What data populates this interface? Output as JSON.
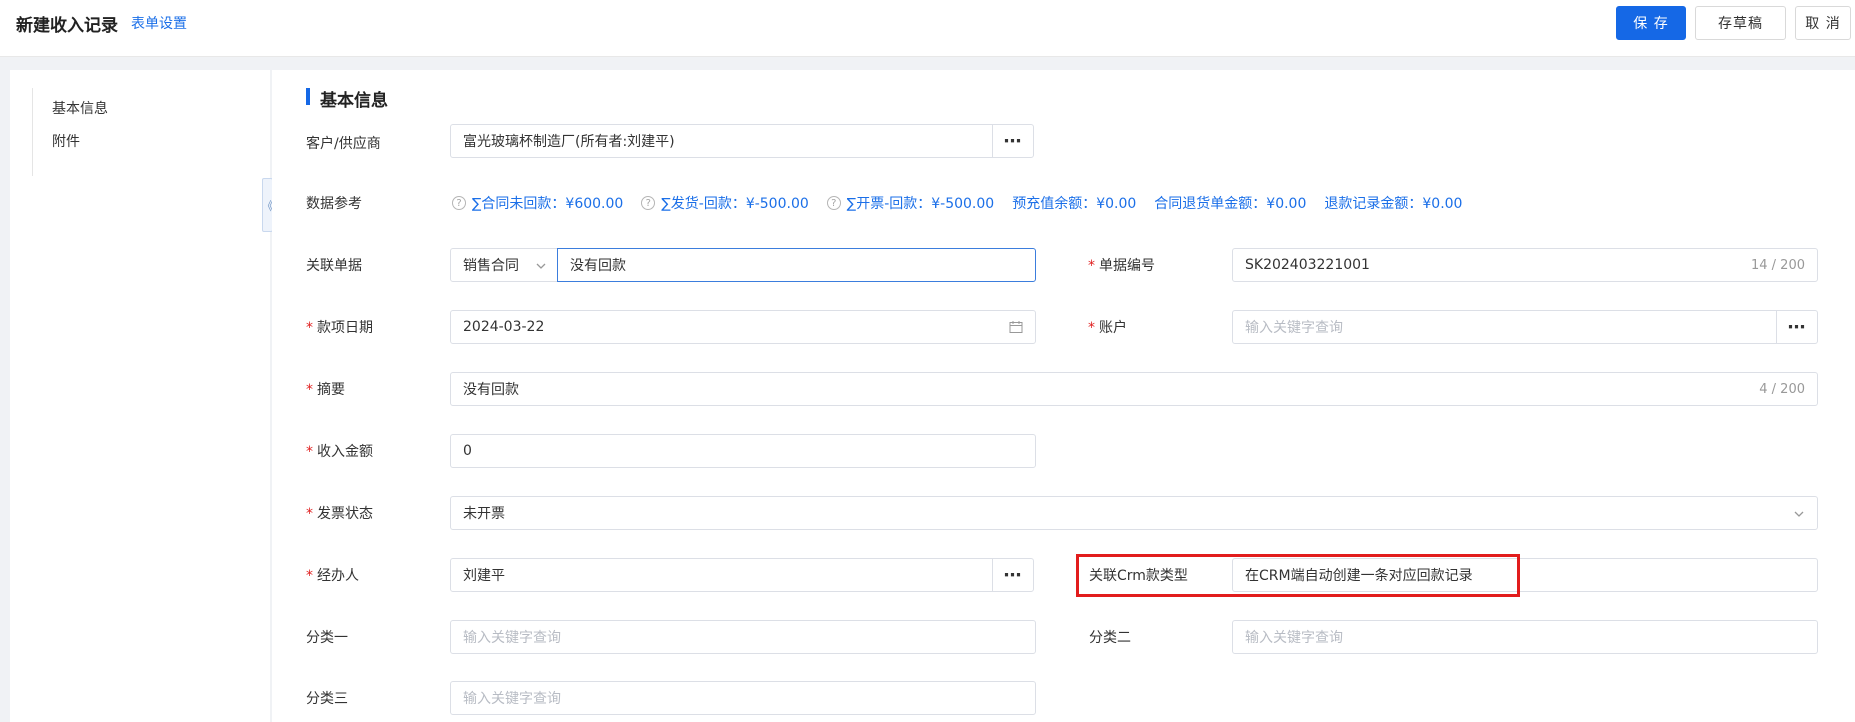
{
  "header": {
    "title": "新建收入记录",
    "form_settings": "表单设置",
    "save": "保 存",
    "draft": "存草稿",
    "cancel": "取 消"
  },
  "sidebar": {
    "items": [
      {
        "label": "基本信息"
      },
      {
        "label": "附件"
      }
    ],
    "collapse_glyph": "《"
  },
  "section": {
    "title": "基本信息"
  },
  "form": {
    "customer": {
      "label": "客户/供应商",
      "value": "富光玻璃杯制造厂(所有者:刘建平)"
    },
    "data_ref": {
      "label": "数据参考",
      "items": [
        "∑合同未回款：¥600.00",
        "∑发货-回款：¥-500.00",
        "∑开票-回款：¥-500.00",
        "预充值余额：¥0.00",
        "合同退货单金额：¥0.00",
        "退款记录金额：¥0.00"
      ]
    },
    "related_doc": {
      "label": "关联单据",
      "type_value": "销售合同",
      "value": "没有回款"
    },
    "doc_no": {
      "label": "单据编号",
      "value": "SK202403221001",
      "counter": "14 / 200"
    },
    "date": {
      "label": "款项日期",
      "value": "2024-03-22"
    },
    "account": {
      "label": "账户",
      "placeholder": "输入关键字查询"
    },
    "summary": {
      "label": "摘要",
      "value": "没有回款",
      "counter": "4 / 200"
    },
    "amount": {
      "label": "收入金额",
      "value": "0"
    },
    "invoice_status": {
      "label": "发票状态",
      "value": "未开票"
    },
    "handler": {
      "label": "经办人",
      "value": "刘建平"
    },
    "crm_type": {
      "label": "关联Crm款类型",
      "value": "在CRM端自动创建一条对应回款记录"
    },
    "cat1": {
      "label": "分类一",
      "placeholder": "输入关键字查询"
    },
    "cat2": {
      "label": "分类二",
      "placeholder": "输入关键字查询"
    },
    "cat3": {
      "label": "分类三",
      "placeholder": "输入关键字查询"
    }
  },
  "colors": {
    "primary": "#1568e6",
    "link": "#1b6fe8",
    "required": "#e02020",
    "highlight": "#e21c1c"
  }
}
